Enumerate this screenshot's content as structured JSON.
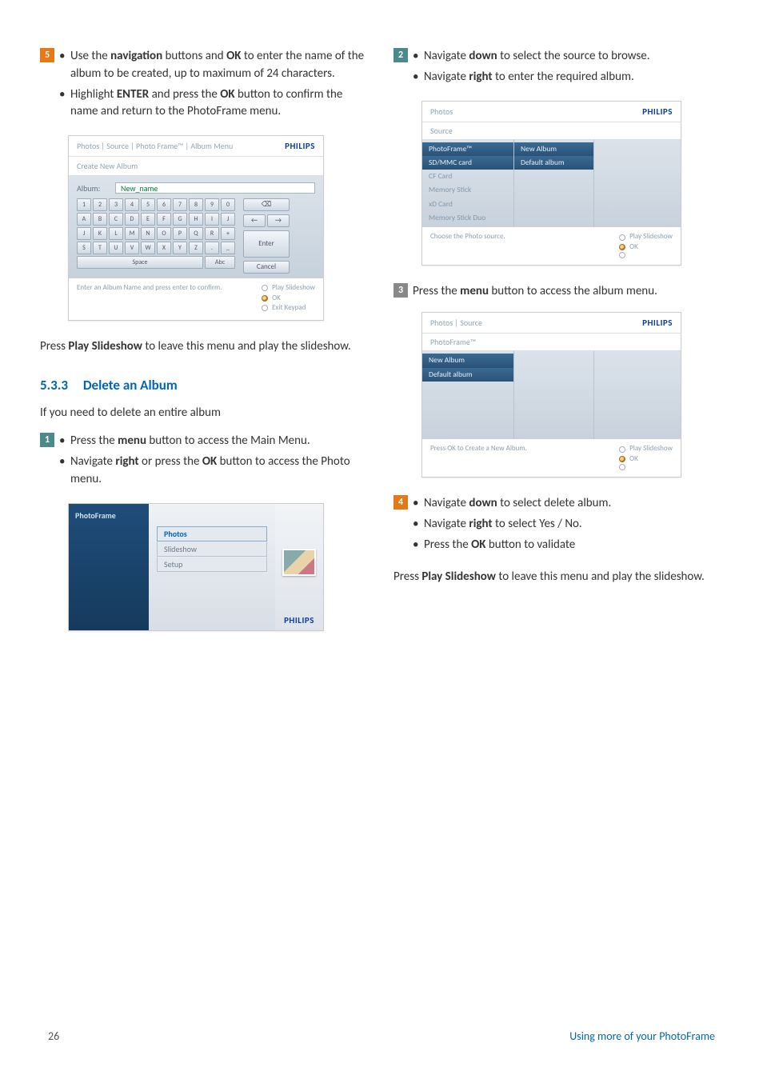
{
  "left": {
    "step5": {
      "num": "5",
      "b1a": "Use the ",
      "b1b": "navigation",
      "b1c": " buttons and ",
      "b1d": "OK",
      "b1e": " to enter the name of the album to be created, up to maximum of 24 characters.",
      "b2a": "Highlight ",
      "b2b": "ENTER",
      "b2c": " and press the ",
      "b2d": "OK",
      "b2e": " button to confirm the name and return to the PhotoFrame menu."
    },
    "ss_keypad": {
      "breadcrumb": "Photos | Source | Photo Frame™ | Album Menu",
      "brand": "PHILIPS",
      "subtitle": "Create New Album",
      "album_label": "Album:",
      "album_value": "New_name",
      "keys_r1": [
        "1",
        "2",
        "3",
        "4",
        "5",
        "6",
        "7",
        "8",
        "9",
        "0"
      ],
      "keys_r2": [
        "A",
        "B",
        "C",
        "D",
        "E",
        "F",
        "G",
        "H",
        "I",
        "J"
      ],
      "keys_r3": [
        "J",
        "K",
        "L",
        "M",
        "N",
        "O",
        "P",
        "Q",
        "R",
        "+"
      ],
      "keys_r4": [
        "S",
        "T",
        "U",
        "V",
        "W",
        "X",
        "Y",
        "Z",
        ".",
        "_"
      ],
      "space": "Space",
      "abc": "Abc",
      "side_back": "⌫",
      "side_left": "←",
      "side_right": "→",
      "side_enter": "Enter",
      "side_cancel": "Cancel",
      "footer_text": "Enter an Album Name and press enter to confirm.",
      "opt1": "Play Slideshow",
      "opt2": "OK",
      "opt3": "Exit Keypad"
    },
    "slideshow_a": "Press ",
    "slideshow_b": "Play Slideshow",
    "slideshow_c": " to leave this menu and play the slideshow.",
    "section_num": "5.3.3",
    "section_title": "Delete an Album",
    "intro": "If you need to delete an entire album",
    "step1": {
      "num": "1",
      "b1a": "Press the ",
      "b1b": "menu",
      "b1c": " button to access the Main Menu.",
      "b2a": "Navigate ",
      "b2b": "right",
      "b2c": " or press the ",
      "b2d": "OK",
      "b2e": " button to access the Photo menu."
    },
    "ss_main": {
      "left_label": "PhotoFrame",
      "items": [
        "Photos",
        "Slideshow",
        "Setup"
      ],
      "brand": "PHILIPS"
    }
  },
  "right": {
    "step2": {
      "num": "2",
      "b1a": "Navigate ",
      "b1b": "down",
      "b1c": " to select the source to browse.",
      "b2a": "Navigate ",
      "b2b": "right",
      "b2c": " to enter the required album."
    },
    "ss_src": {
      "title": "Photos",
      "brand": "PHILIPS",
      "subtitle": "Source",
      "colA": [
        "PhotoFrame™",
        "SD/MMC card",
        "CF Card",
        "Memory Stick",
        "xD Card",
        "Memory Stick Duo"
      ],
      "colB": [
        "New Album",
        "Default album"
      ],
      "footer_text": "Choose the Photo source.",
      "opt1": "Play Slideshow",
      "opt2": "OK"
    },
    "step3": {
      "num": "3",
      "t1": "Press the ",
      "t2": "menu",
      "t3": " button to access the album menu."
    },
    "ss_alb": {
      "title": "Photos | Source",
      "brand": "PHILIPS",
      "subtitle": "PhotoFrame™",
      "colA": [
        "New Album",
        "Default album"
      ],
      "footer_text": "Press OK to Create a New Album.",
      "opt1": "Play Slideshow",
      "opt2": "OK"
    },
    "step4": {
      "num": "4",
      "b1a": "Navigate ",
      "b1b": "down",
      "b1c": " to select delete album.",
      "b2a": "Navigate ",
      "b2b": "right",
      "b2c": " to select Yes / No.",
      "b3a": "Press the ",
      "b3b": "OK",
      "b3c": " button to validate"
    },
    "slideshow_a": "Press ",
    "slideshow_b": "Play Slideshow",
    "slideshow_c": " to leave this menu and play the slideshow."
  },
  "footer": {
    "page": "26",
    "title": "Using more of your PhotoFrame"
  }
}
